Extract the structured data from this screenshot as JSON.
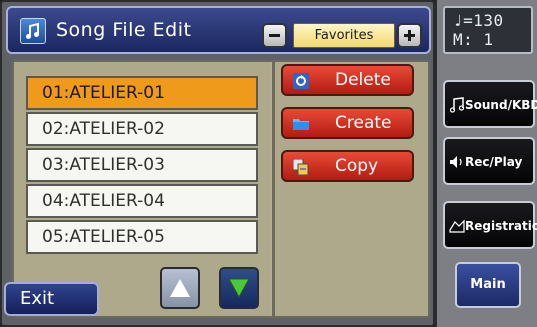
{
  "window": {
    "title": "Song File Edit",
    "icon": "music-note-icon"
  },
  "favorites": {
    "label": "Favorites",
    "minus_icon": "minus-icon",
    "plus_icon": "plus-icon"
  },
  "file_list": {
    "items": [
      {
        "label": "01:ATELIER-01",
        "selected": true
      },
      {
        "label": "02:ATELIER-02",
        "selected": false
      },
      {
        "label": "03:ATELIER-03",
        "selected": false
      },
      {
        "label": "04:ATELIER-04",
        "selected": false
      },
      {
        "label": "05:ATELIER-05",
        "selected": false
      }
    ]
  },
  "actions": {
    "delete": {
      "label": "Delete",
      "icon": "delete-icon"
    },
    "create": {
      "label": "Create",
      "icon": "folder-icon"
    },
    "copy": {
      "label": "Copy",
      "icon": "copy-icon"
    }
  },
  "bottom": {
    "exit_label": "Exit",
    "up_icon": "triangle-up-icon",
    "down_icon": "triangle-down-icon"
  },
  "status": {
    "tempo_line": "♩=130",
    "measure_line": "M:   1"
  },
  "side_buttons": {
    "sound_kbd": {
      "label": "Sound/KBD",
      "icon": "note-icon"
    },
    "rec_play": {
      "label": "Rec/Play",
      "icon": "speaker-icon"
    },
    "registration": {
      "label": "Registration",
      "icon": "registration-icon"
    },
    "main": {
      "label": "Main"
    }
  },
  "colors": {
    "selected_row": "#f09a1c",
    "action_button": "#d0301f",
    "favorites_field": "#f6e08a",
    "down_arrow": "#4ec63a"
  }
}
